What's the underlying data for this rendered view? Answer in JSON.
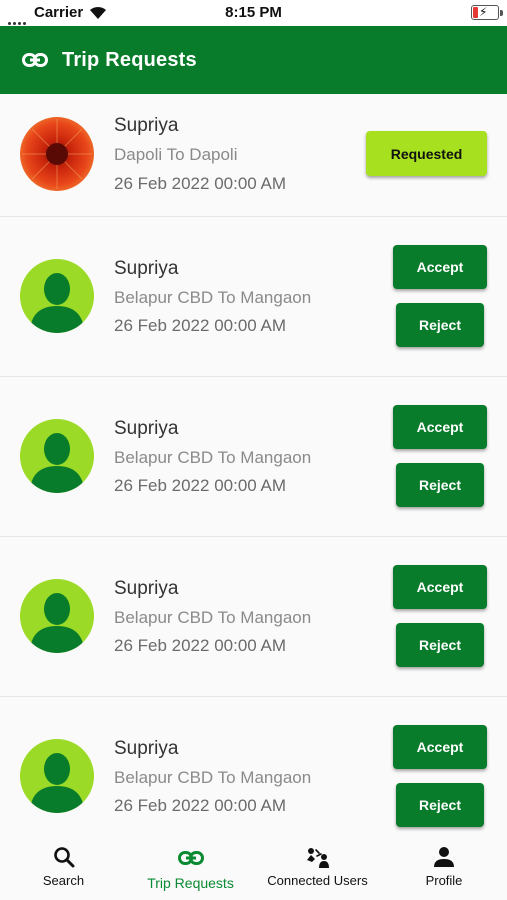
{
  "status_bar": {
    "carrier": "Carrier",
    "time": "8:15 PM"
  },
  "app_bar": {
    "title": "Trip Requests",
    "icon": "link-icon"
  },
  "colors": {
    "primary": "#087c2a",
    "requested": "#a6e01e",
    "avatar_green": "#9bdb27",
    "active_tab": "#0a8a32"
  },
  "requests": [
    {
      "name": "Supriya",
      "route": "Dapoli To Dapoli",
      "date": "26 Feb 2022 00:00 AM",
      "avatar": "flower-photo",
      "status_label": "Requested"
    },
    {
      "name": "Supriya",
      "route": "Belapur CBD To Mangaon",
      "date": "26 Feb 2022 00:00 AM",
      "avatar": "person-placeholder",
      "accept_label": "Accept",
      "reject_label": "Reject"
    },
    {
      "name": "Supriya",
      "route": "Belapur CBD To Mangaon",
      "date": "26 Feb 2022 00:00 AM",
      "avatar": "person-placeholder",
      "accept_label": "Accept",
      "reject_label": "Reject"
    },
    {
      "name": "Supriya",
      "route": "Belapur CBD To Mangaon",
      "date": "26 Feb 2022 00:00 AM",
      "avatar": "person-placeholder",
      "accept_label": "Accept",
      "reject_label": "Reject"
    },
    {
      "name": "Supriya",
      "route": "Belapur CBD To Mangaon",
      "date": "26 Feb 2022 00:00 AM",
      "avatar": "person-placeholder",
      "accept_label": "Accept",
      "reject_label": "Reject"
    }
  ],
  "bottom_nav": {
    "items": [
      {
        "label": "Search",
        "icon": "search-icon"
      },
      {
        "label": "Trip Requests",
        "icon": "link-icon",
        "active": true
      },
      {
        "label": "Connected Users",
        "icon": "connected-users-icon"
      },
      {
        "label": "Profile",
        "icon": "person-icon"
      }
    ]
  }
}
